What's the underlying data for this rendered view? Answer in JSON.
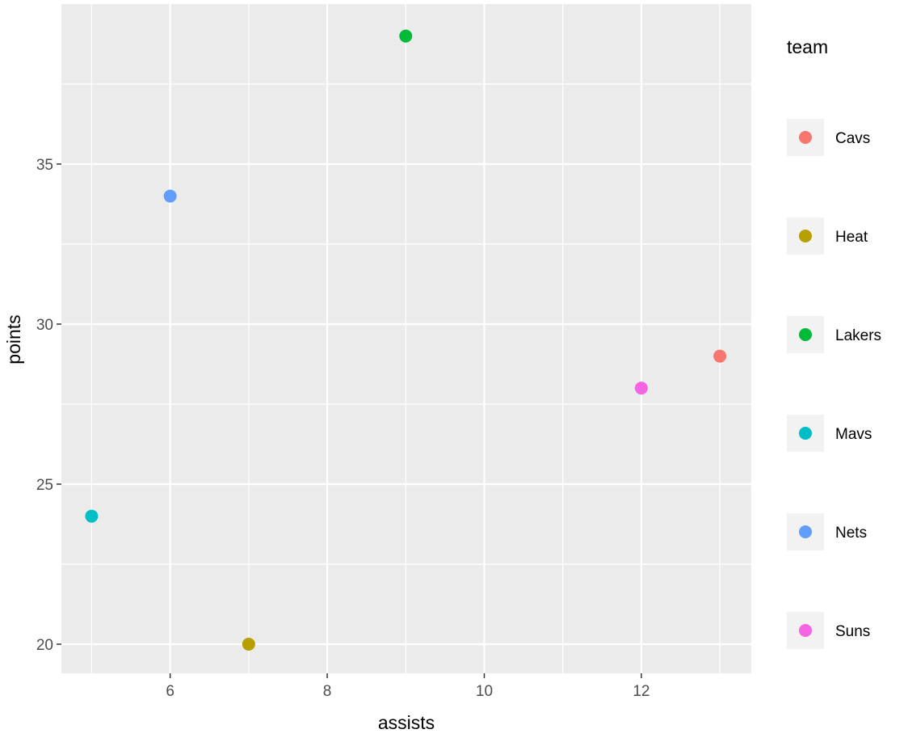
{
  "chart_data": {
    "type": "scatter",
    "title": "",
    "xlabel": "assists",
    "ylabel": "points",
    "xlim": [
      4.615,
      13.4
    ],
    "ylim": [
      19.09,
      40.0
    ],
    "x_ticks": [
      6,
      8,
      10,
      12
    ],
    "x_tick_labels": [
      "6",
      "8",
      "10",
      "12"
    ],
    "x_minor_gridlines": [
      5,
      7,
      9,
      11,
      13
    ],
    "y_ticks": [
      20,
      25,
      30,
      35
    ],
    "y_tick_labels": [
      "20",
      "25",
      "30",
      "35"
    ],
    "y_minor_gridlines": [
      22.5,
      27.5,
      32.5,
      37.5
    ],
    "grid": true,
    "legend": {
      "title": "team",
      "placement": "right",
      "entries": [
        {
          "label": "Cavs",
          "color": "#F8766D"
        },
        {
          "label": "Heat",
          "color": "#B79F00"
        },
        {
          "label": "Lakers",
          "color": "#00BA38"
        },
        {
          "label": "Mavs",
          "color": "#00BFC4"
        },
        {
          "label": "Nets",
          "color": "#619CFF"
        },
        {
          "label": "Suns",
          "color": "#F564E3"
        }
      ]
    },
    "series": [
      {
        "name": "Cavs",
        "color": "#F8766D",
        "points": [
          {
            "x": 13,
            "y": 29
          }
        ]
      },
      {
        "name": "Heat",
        "color": "#B79F00",
        "points": [
          {
            "x": 7,
            "y": 20
          }
        ]
      },
      {
        "name": "Lakers",
        "color": "#00BA38",
        "points": [
          {
            "x": 9,
            "y": 39
          }
        ]
      },
      {
        "name": "Mavs",
        "color": "#00BFC4",
        "points": [
          {
            "x": 5,
            "y": 24
          }
        ]
      },
      {
        "name": "Nets",
        "color": "#619CFF",
        "points": [
          {
            "x": 6,
            "y": 34
          }
        ]
      },
      {
        "name": "Suns",
        "color": "#F564E3",
        "points": [
          {
            "x": 12,
            "y": 28
          }
        ]
      }
    ],
    "colors": {
      "panel_background": "#EBEBEB",
      "grid": "#FFFFFF",
      "legend_key_background": "#F2F2F2",
      "tick_text": "#4D4D4D",
      "tick_mark": "#333333"
    }
  }
}
